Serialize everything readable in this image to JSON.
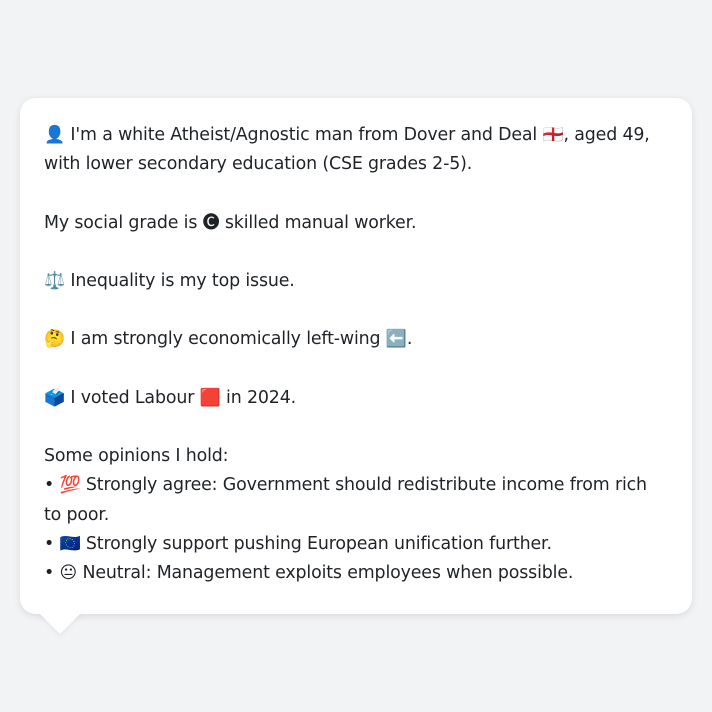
{
  "profile": {
    "identity": {
      "icon": "👤",
      "text": "I'm a white Atheist/Agnostic man from Dover and Deal",
      "flag": "🏴󠁧󠁢󠁥󠁮󠁧󠁿",
      "text_after_flag": ", aged 49, with lower secondary education (CSE grades 2-5)."
    },
    "social_grade": {
      "text_before": "My social grade is",
      "icon": "🅒",
      "text_after": "skilled manual worker."
    },
    "top_issue": {
      "icon": "⚖️",
      "text": "Inequality is my top issue."
    },
    "economics": {
      "icon": "🤔",
      "text": "I am strongly economically left-wing",
      "arrow_icon": "⬅️",
      "suffix": "."
    },
    "vote": {
      "icon": "🗳️",
      "text_before": "I voted Labour",
      "party_icon": "🟥",
      "text_after": "in 2024."
    },
    "opinions_heading": "Some opinions I hold:",
    "opinions": [
      {
        "bullet": "•",
        "icon": "💯",
        "text": "Strongly agree: Government should redistribute income from rich to poor."
      },
      {
        "bullet": "•",
        "icon": "🇪🇺",
        "text": "Strongly support pushing European unification further."
      },
      {
        "bullet": "•",
        "icon": "😐",
        "text": "Neutral: Management exploits employees when possible."
      }
    ]
  },
  "colors": {
    "background": "#f2f3f5",
    "bubble": "#ffffff",
    "text": "#1f2328"
  }
}
